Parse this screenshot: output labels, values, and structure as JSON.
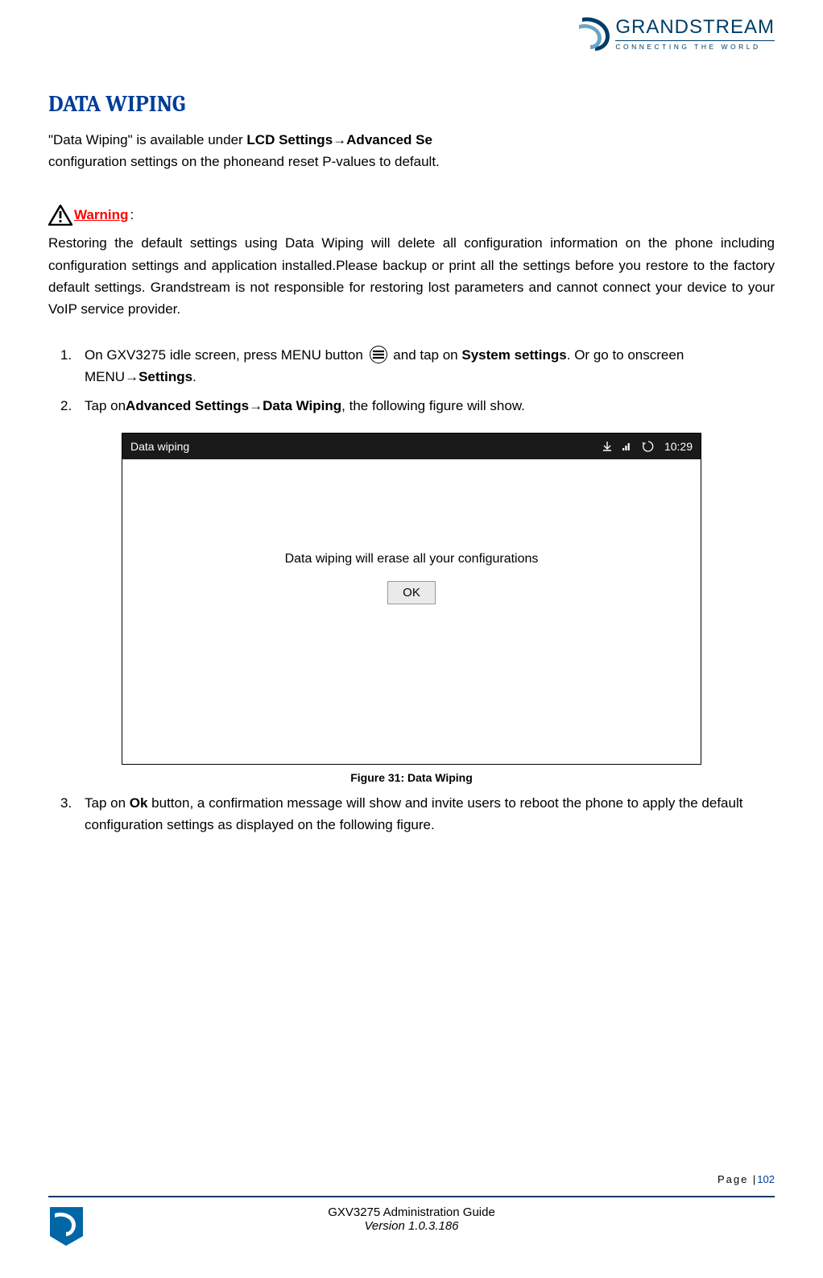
{
  "logo": {
    "brand": "GRANDSTREAM",
    "tagline": "CONNECTING THE WORLD"
  },
  "section_title": "DATA WIPING",
  "intro": {
    "part1": "\"Data Wiping\" is available under ",
    "bold1": "LCD Settings",
    "arrow1": "→",
    "bold2": "Advanced Se",
    "part2": "configuration settings on the phoneand reset P-values to default."
  },
  "warning": {
    "label": "Warning",
    "colon": ":",
    "text": "Restoring the default settings using Data Wiping will delete all configuration information on the phone including configuration settings and application installed.Please backup or print all the settings before you restore to the factory default settings. Grandstream is not responsible for restoring lost parameters and cannot connect your device to your VoIP service provider."
  },
  "steps": {
    "s1": {
      "num": "1.",
      "t1": "On GXV3275 idle screen, press MENU button ",
      "t2": " and tap on ",
      "bold1": "System settings",
      "t3": ". Or go to onscreen MENU",
      "arrow": "→",
      "bold2": "Settings",
      "t4": "."
    },
    "s2": {
      "num": "2.",
      "t1": "Tap on",
      "bold1": "Advanced Settings",
      "arrow": "→",
      "bold2": "Data Wiping",
      "t2": ", the following figure will show."
    },
    "s3": {
      "num": "3.",
      "t1": "Tap on ",
      "bold1": "Ok",
      "t2": " button, a confirmation message will show and invite users to reboot the phone to apply the default configuration settings as displayed on the following figure."
    }
  },
  "figure": {
    "status_title": "Data wiping",
    "status_time": "10:29",
    "message": "Data wiping will erase all your configurations",
    "ok": "OK",
    "caption": "Figure 31: Data Wiping"
  },
  "footer": {
    "guide": "GXV3275 Administration Guide",
    "version": "Version 1.0.3.186",
    "page_label": "Page |",
    "page_number": "102"
  }
}
